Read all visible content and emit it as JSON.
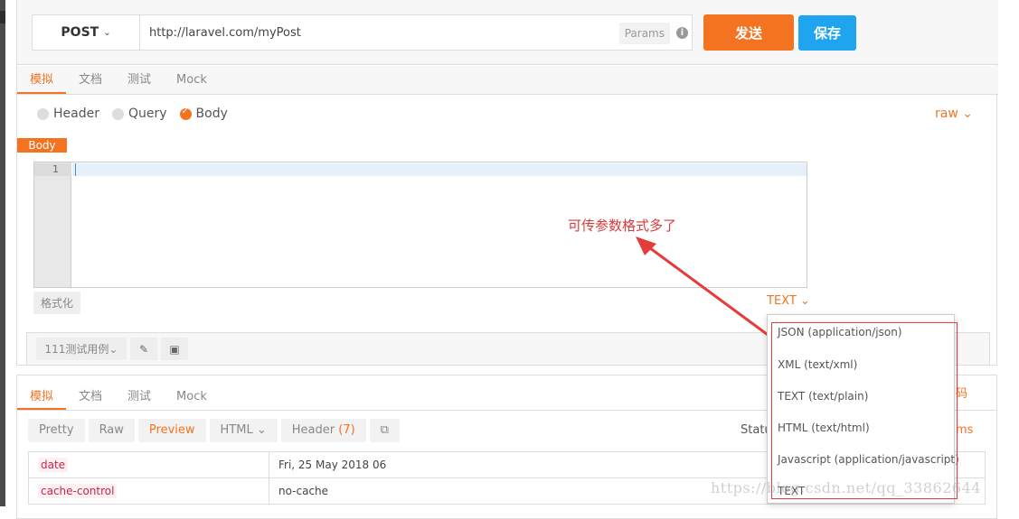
{
  "request": {
    "method": "POST",
    "url": "http://laravel.com/myPost",
    "params_label": "Params",
    "info_icon": "i",
    "send_label": "发送",
    "save_label": "保存",
    "tabs": [
      {
        "label": "模拟",
        "active": true
      },
      {
        "label": "文档",
        "active": false
      },
      {
        "label": "测试",
        "active": false
      },
      {
        "label": "Mock",
        "active": false
      }
    ],
    "options": [
      {
        "label": "Header",
        "checked": false
      },
      {
        "label": "Query",
        "checked": false
      },
      {
        "label": "Body",
        "checked": true
      }
    ],
    "raw_label": "raw",
    "body_tag": "Body",
    "editor_line": "1",
    "format_label": "格式化",
    "text_select": "TEXT",
    "case_select": "111测试用例",
    "edit_icon": "pencil-icon",
    "save_icon": "floppy-icon"
  },
  "response": {
    "tabs": [
      {
        "label": "模拟",
        "active": true
      },
      {
        "label": "文档",
        "active": false
      },
      {
        "label": "测试",
        "active": false
      },
      {
        "label": "Mock",
        "active": false
      }
    ],
    "side_text": "码",
    "toolbar": {
      "pretty": "Pretty",
      "raw": "Raw",
      "preview": "Preview",
      "html": "HTML",
      "header": "Header",
      "header_count": "(7)",
      "copy_icon": "copy-icon"
    },
    "status_label": "Statu",
    "time": "ms",
    "headers": [
      {
        "key": "date",
        "value": "Fri, 25 May 2018 06"
      },
      {
        "key": "cache-control",
        "value": "no-cache"
      }
    ]
  },
  "annotation": {
    "text": "可传参数格式多了",
    "color": "#d93a3a"
  },
  "dropdown": {
    "items": [
      "JSON (application/json)",
      "XML (text/xml)",
      "TEXT (text/plain)",
      "HTML (text/html)",
      "Javascript (application/javascript)",
      "TEXT"
    ]
  },
  "watermark": "https://blog.csdn.net/qq_33862644",
  "colors": {
    "accent": "#f47321",
    "save_button": "#1fa4ef",
    "annotation_red": "#e53b3b"
  }
}
